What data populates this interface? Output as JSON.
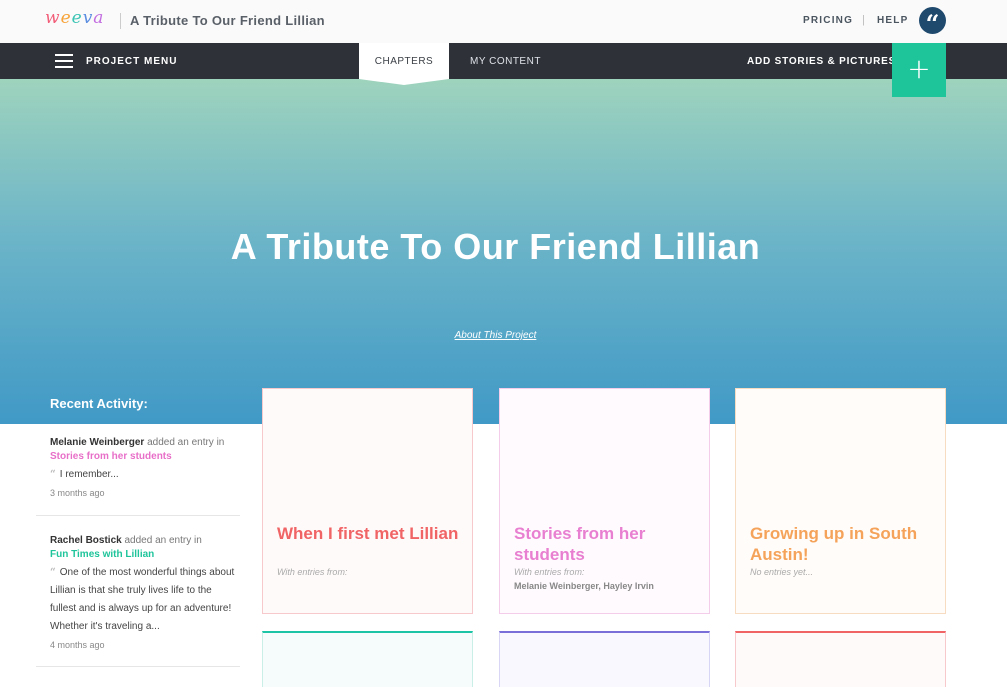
{
  "app": {
    "logo_letters": [
      "w",
      "e",
      "e",
      "v",
      "a"
    ],
    "logo_colors": [
      "#f25f7a",
      "#f7a43a",
      "#3cc4b4",
      "#5b8de0",
      "#c36ee0"
    ],
    "project_title": "A Tribute To Our Friend Lillian"
  },
  "header": {
    "pricing": "PRICING",
    "separator": "|",
    "help": "HELP",
    "quote_icon": "“"
  },
  "nav": {
    "project_menu": "PROJECT MENU",
    "tabs": [
      {
        "label": "CHAPTERS",
        "active": true
      },
      {
        "label": "MY CONTENT",
        "active": false
      }
    ],
    "add_stories": "ADD STORIES & PICTURES",
    "add_icon": "+",
    "accent": "#1ec49a"
  },
  "hero": {
    "title": "A Tribute To Our Friend Lillian",
    "about_link": "About This Project"
  },
  "recent_activity": {
    "heading": "Recent Activity:",
    "items": [
      {
        "who": "Melanie Weinberger",
        "action": "added an entry in",
        "chapter": "Stories from her students",
        "chapter_color": "#e86fc8",
        "excerpt": "I remember...",
        "ago": "3 months ago"
      },
      {
        "who": "Rachel Bostick",
        "action": "added an entry in",
        "chapter": "Fun Times with Lillian",
        "chapter_color": "#1ec49a",
        "excerpt": "One of the most wonderful things about Lillian is that she truly lives life to the fullest and is always up for an adventure! Whether it's traveling a...",
        "ago": "4 months ago"
      }
    ]
  },
  "chapters": [
    {
      "title": "When I first met Lillian",
      "meta": "With entries from:",
      "names": "",
      "color": "#f06466",
      "bg": "#fffafa",
      "border": "#f7c9cc"
    },
    {
      "title": "Stories from her students",
      "meta": "With entries from:",
      "names": "Melanie Weinberger, Hayley Irvin",
      "color": "#e87fd0",
      "bg": "#fffafe",
      "border": "#f3cdea"
    },
    {
      "title": "Growing up in South Austin!",
      "meta": "No entries yet...",
      "names": "",
      "color": "#f5a35a",
      "bg": "#fffcf9",
      "border": "#f7dcc2"
    }
  ],
  "chapters_row2": [
    {
      "color": "#1ec4a6",
      "bg": "#f5fcfb"
    },
    {
      "color": "#7a6fd9",
      "bg": "#f8f8fe"
    },
    {
      "color": "#f06466",
      "bg": "#fffafa"
    }
  ]
}
